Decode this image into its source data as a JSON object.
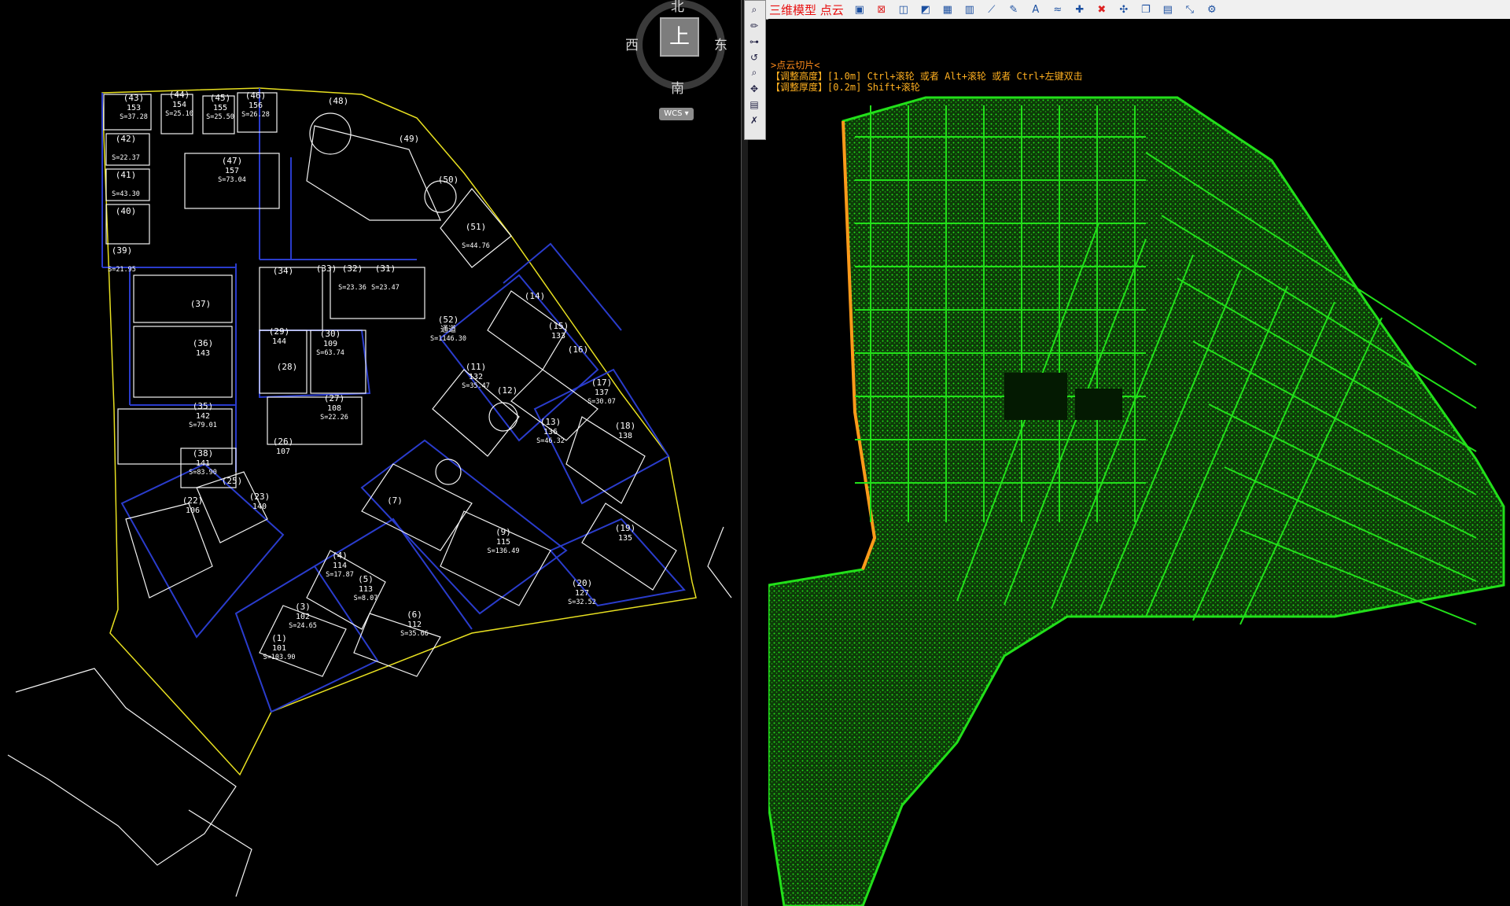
{
  "compass": {
    "north": "北",
    "south": "南",
    "west": "西",
    "east": "东",
    "cube_face": "上"
  },
  "wcs_label": "WCS",
  "plan_labels": [
    {
      "id": "(43)",
      "num": "153",
      "area": "S=37.28"
    },
    {
      "id": "(44)",
      "num": "154",
      "area": "S=25.10"
    },
    {
      "id": "(45)",
      "num": "155",
      "area": "S=25.50"
    },
    {
      "id": "(46)",
      "num": "156",
      "area": "S=26.28"
    },
    {
      "id": "(48)",
      "num": "",
      "area": ""
    },
    {
      "id": "(47)",
      "num": "157",
      "area": "S=73.04"
    },
    {
      "id": "(42)",
      "num": "",
      "area": "S=22.37"
    },
    {
      "id": "(41)",
      "num": "",
      "area": "S=43.30"
    },
    {
      "id": "(40)",
      "num": "",
      "area": ""
    },
    {
      "id": "(39)",
      "num": "",
      "area": "S=21.95"
    },
    {
      "id": "(49)",
      "num": "",
      "area": ""
    },
    {
      "id": "(50)",
      "num": "",
      "area": ""
    },
    {
      "id": "(51)",
      "num": "",
      "area": "S=44.76"
    },
    {
      "id": "(33)",
      "num": "",
      "area": ""
    },
    {
      "id": "(34)",
      "num": "",
      "area": ""
    },
    {
      "id": "(32)",
      "num": "",
      "area": "S=23.36"
    },
    {
      "id": "(31)",
      "num": "",
      "area": "S=23.47"
    },
    {
      "id": "(52)",
      "num": "通道",
      "area": "S=1146.30"
    },
    {
      "id": "(37)",
      "num": "",
      "area": ""
    },
    {
      "id": "(36)",
      "num": "143",
      "area": ""
    },
    {
      "id": "(29)",
      "num": "144",
      "area": ""
    },
    {
      "id": "(30)",
      "num": "109",
      "area": "S=63.74"
    },
    {
      "id": "(28)",
      "num": "",
      "area": ""
    },
    {
      "id": "(35)",
      "num": "142",
      "area": "S=79.01"
    },
    {
      "id": "(27)",
      "num": "108",
      "area": "S=22.26"
    },
    {
      "id": "(14)",
      "num": "",
      "area": ""
    },
    {
      "id": "(15)",
      "num": "133",
      "area": ""
    },
    {
      "id": "(16)",
      "num": "",
      "area": ""
    },
    {
      "id": "(17)",
      "num": "137",
      "area": "S=30.07"
    },
    {
      "id": "(11)",
      "num": "132",
      "area": "S=35.47"
    },
    {
      "id": "(12)",
      "num": "",
      "area": ""
    },
    {
      "id": "(13)",
      "num": "136",
      "area": "S=46.32"
    },
    {
      "id": "(18)",
      "num": "138",
      "area": ""
    },
    {
      "id": "(38)",
      "num": "141",
      "area": "S=83.90"
    },
    {
      "id": "(26)",
      "num": "107",
      "area": ""
    },
    {
      "id": "(22)",
      "num": "106",
      "area": ""
    },
    {
      "id": "(23)",
      "num": "140",
      "area": ""
    },
    {
      "id": "(7)",
      "num": "",
      "area": ""
    },
    {
      "id": "(9)",
      "num": "115",
      "area": "S=136.49"
    },
    {
      "id": "(19)",
      "num": "135",
      "area": ""
    },
    {
      "id": "(4)",
      "num": "114",
      "area": "S=17.87"
    },
    {
      "id": "(5)",
      "num": "113",
      "area": "S=8.07"
    },
    {
      "id": "(3)",
      "num": "102",
      "area": "S=24.65"
    },
    {
      "id": "(6)",
      "num": "112",
      "area": "S=35.66"
    },
    {
      "id": "(20)",
      "num": "127",
      "area": "S=32.52"
    },
    {
      "id": "(1)",
      "num": "101",
      "area": "S=103.90"
    },
    {
      "id": "(25)",
      "num": "",
      "area": ""
    }
  ],
  "toolbar": {
    "title": "三维模型 点云",
    "buttons": [
      "model-box-icon",
      "delete-box-icon",
      "split-icon",
      "surface-icon",
      "profile-icon",
      "chart-icon",
      "line-tool-icon",
      "pen-icon",
      "auto-icon",
      "wave-icon",
      "point-add-icon",
      "point-remove-icon",
      "point-move-icon",
      "copy-icon",
      "layer-icon",
      "vector-icon",
      "settings-icon"
    ]
  },
  "vtools": [
    "zoom-icon",
    "pencil-icon",
    "node-icon",
    "curve-icon",
    "search-icon",
    "pan-icon",
    "layer-icon",
    "clear-icon"
  ],
  "prompt": {
    "line1": ">点云切片<",
    "line2": "【调整高度】[1.0m] Ctrl+滚轮 或者 Alt+滚轮 或者 Ctrl+左键双击",
    "line3": "【调整厚度】[0.2m] Shift+滚轮"
  },
  "colors": {
    "cloud": "#22e01a",
    "cloud_edge": "#ff9a1a",
    "lines": "#ffffff",
    "property": "#2a3ccc",
    "boundary": "#e8e020"
  }
}
